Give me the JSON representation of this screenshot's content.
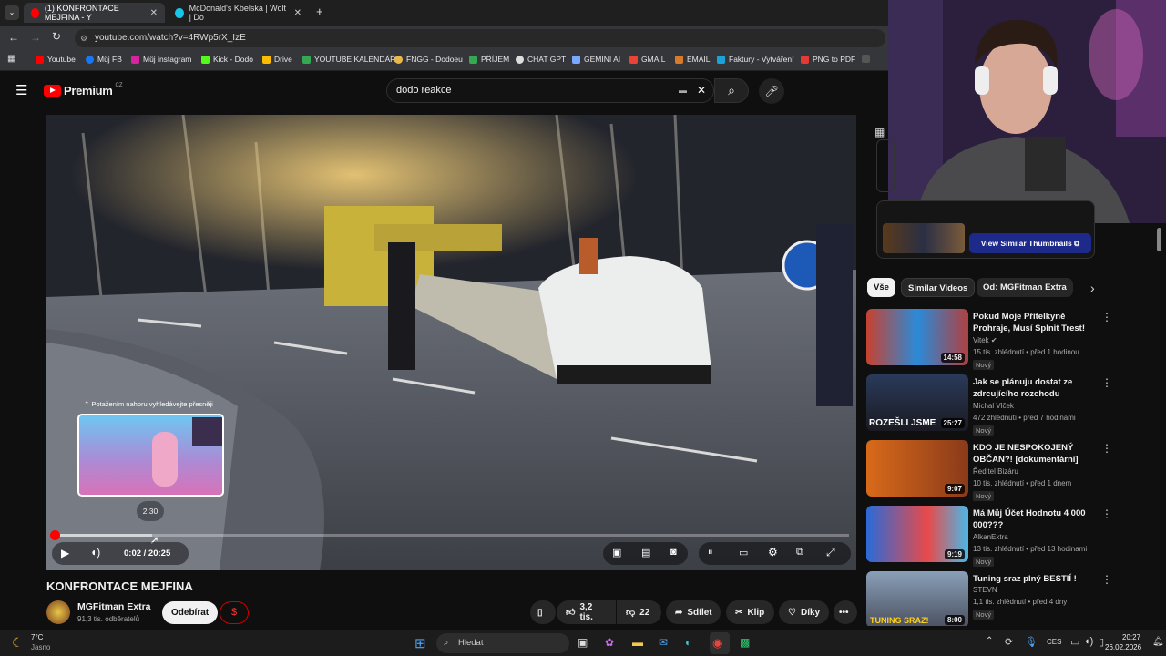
{
  "browser": {
    "tabs": [
      {
        "label": "(1) KONFRONTACE MEJFINA - Y"
      },
      {
        "label": "McDonald's Kbelská | Wolt | Do"
      }
    ],
    "url": "youtube.com/watch?v=4RWp5rX_IzE",
    "bookmarks": [
      "Youtube",
      "Můj FB",
      "Můj instagram",
      "Kick - Dodo",
      "Drive",
      "YOUTUBE KALENDÁŘ",
      "FNGG - Dodoeu",
      "PŘÍJEM",
      "CHAT GPT",
      "GEMINI AI",
      "GMAIL",
      "EMAIL",
      "Faktury - Vytváření",
      "PNG to PDF"
    ]
  },
  "youtube": {
    "logo": "Premium",
    "region": "CZ",
    "search_value": "dodo reakce"
  },
  "player": {
    "seek_hint": "Potažením nahoru vyhledávejte přesněji",
    "preview_time": "2:30",
    "time": "0:02 / 20:25",
    "progress": 0.002
  },
  "video": {
    "title": "KONFRONTACE MEJFINA",
    "channel": "MGFitman Extra",
    "subs": "91,3 tis. odběratelů",
    "subscribe": "Odebírat",
    "likes": "3,2 tis.",
    "dislikes": "22",
    "share": "Sdílet",
    "clip": "Klip",
    "thanks": "Díky"
  },
  "sidebar": {
    "view_similar": "View Similar Thumbnails",
    "chips": [
      "Vše",
      "Similar Videos",
      "Od: MGFitman Extra"
    ],
    "videos": [
      {
        "title": "Pokud Moje Přítelkyně Prohraje, Musí Splnit Trest!",
        "channel": "Vitek",
        "meta": "15 tis. zhlédnutí • před 1 hodinou",
        "badge": "Nový",
        "duration": "14:58"
      },
      {
        "title": "Jak se plánuju dostat ze zdrcujícího rozchodu",
        "channel": "Michal Vlček",
        "meta": "472 zhlédnutí • před 7 hodinami",
        "badge": "Nový",
        "duration": "25:27",
        "thumb_text": "ROZEŠLI JSME"
      },
      {
        "title": "KDO JE NESPOKOJENÝ OBČAN?! [dokumentární]",
        "channel": "Ředitel Bizáru",
        "meta": "10 tis. zhlédnutí • před 1 dnem",
        "badge": "Nový",
        "duration": "9:07"
      },
      {
        "title": "Má Můj Účet Hodnotu 4 000 000???",
        "channel": "AlkanExtra",
        "meta": "13 tis. zhlédnutí • před 13 hodinami",
        "badge": "Nový",
        "duration": "9:19"
      },
      {
        "title": "Tuning sraz plný BESTIÍ !",
        "channel": "STEVN",
        "meta": "1,1 tis. zhlédnutí • před 4 dny",
        "badge": "Nový",
        "duration": "8:00",
        "thumb_text": "TUNING SRAZ!"
      }
    ]
  },
  "taskbar": {
    "weather_temp": "7°C",
    "weather_desc": "Jasno",
    "search": "Hledat",
    "lang": "CES",
    "time": "20:27",
    "date": "26.02.2026"
  },
  "colors": {
    "yt_red": "#ff0000",
    "accent_blue": "#3ea6ff",
    "bg": "#0f0f0f"
  }
}
